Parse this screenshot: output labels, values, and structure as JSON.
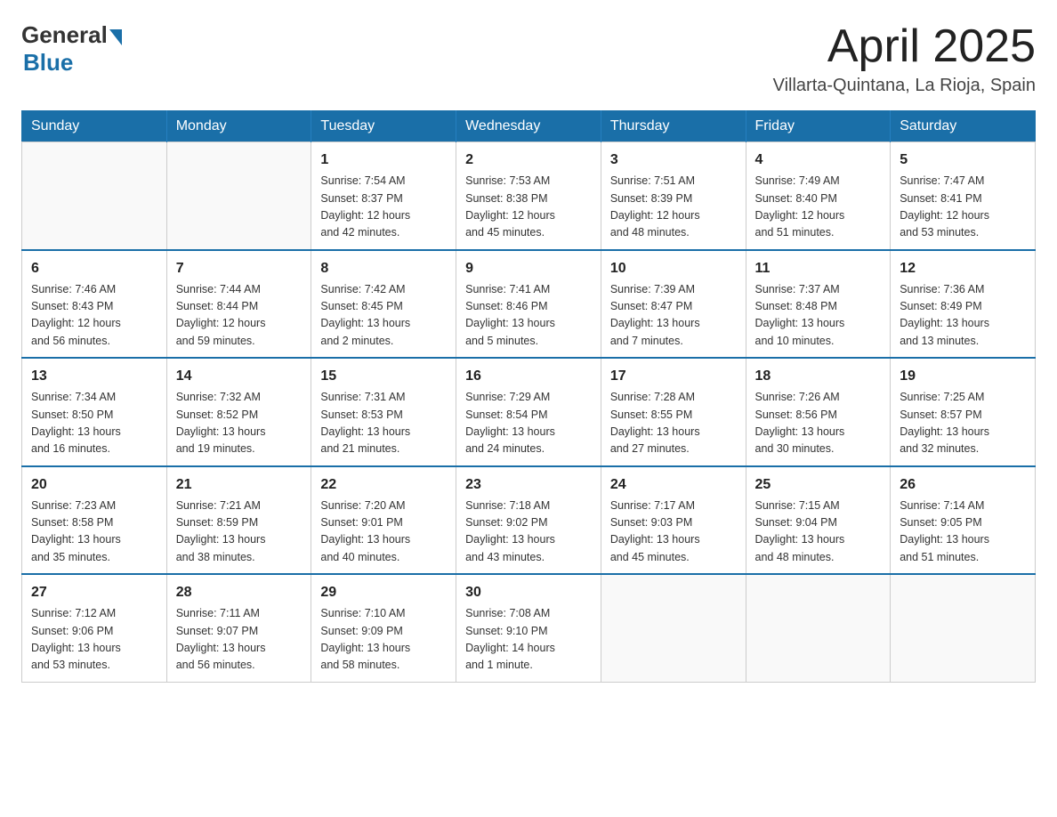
{
  "header": {
    "logo_general": "General",
    "logo_blue": "Blue",
    "title": "April 2025",
    "location": "Villarta-Quintana, La Rioja, Spain"
  },
  "weekdays": [
    "Sunday",
    "Monday",
    "Tuesday",
    "Wednesday",
    "Thursday",
    "Friday",
    "Saturday"
  ],
  "weeks": [
    [
      {
        "day": "",
        "info": ""
      },
      {
        "day": "",
        "info": ""
      },
      {
        "day": "1",
        "info": "Sunrise: 7:54 AM\nSunset: 8:37 PM\nDaylight: 12 hours\nand 42 minutes."
      },
      {
        "day": "2",
        "info": "Sunrise: 7:53 AM\nSunset: 8:38 PM\nDaylight: 12 hours\nand 45 minutes."
      },
      {
        "day": "3",
        "info": "Sunrise: 7:51 AM\nSunset: 8:39 PM\nDaylight: 12 hours\nand 48 minutes."
      },
      {
        "day": "4",
        "info": "Sunrise: 7:49 AM\nSunset: 8:40 PM\nDaylight: 12 hours\nand 51 minutes."
      },
      {
        "day": "5",
        "info": "Sunrise: 7:47 AM\nSunset: 8:41 PM\nDaylight: 12 hours\nand 53 minutes."
      }
    ],
    [
      {
        "day": "6",
        "info": "Sunrise: 7:46 AM\nSunset: 8:43 PM\nDaylight: 12 hours\nand 56 minutes."
      },
      {
        "day": "7",
        "info": "Sunrise: 7:44 AM\nSunset: 8:44 PM\nDaylight: 12 hours\nand 59 minutes."
      },
      {
        "day": "8",
        "info": "Sunrise: 7:42 AM\nSunset: 8:45 PM\nDaylight: 13 hours\nand 2 minutes."
      },
      {
        "day": "9",
        "info": "Sunrise: 7:41 AM\nSunset: 8:46 PM\nDaylight: 13 hours\nand 5 minutes."
      },
      {
        "day": "10",
        "info": "Sunrise: 7:39 AM\nSunset: 8:47 PM\nDaylight: 13 hours\nand 7 minutes."
      },
      {
        "day": "11",
        "info": "Sunrise: 7:37 AM\nSunset: 8:48 PM\nDaylight: 13 hours\nand 10 minutes."
      },
      {
        "day": "12",
        "info": "Sunrise: 7:36 AM\nSunset: 8:49 PM\nDaylight: 13 hours\nand 13 minutes."
      }
    ],
    [
      {
        "day": "13",
        "info": "Sunrise: 7:34 AM\nSunset: 8:50 PM\nDaylight: 13 hours\nand 16 minutes."
      },
      {
        "day": "14",
        "info": "Sunrise: 7:32 AM\nSunset: 8:52 PM\nDaylight: 13 hours\nand 19 minutes."
      },
      {
        "day": "15",
        "info": "Sunrise: 7:31 AM\nSunset: 8:53 PM\nDaylight: 13 hours\nand 21 minutes."
      },
      {
        "day": "16",
        "info": "Sunrise: 7:29 AM\nSunset: 8:54 PM\nDaylight: 13 hours\nand 24 minutes."
      },
      {
        "day": "17",
        "info": "Sunrise: 7:28 AM\nSunset: 8:55 PM\nDaylight: 13 hours\nand 27 minutes."
      },
      {
        "day": "18",
        "info": "Sunrise: 7:26 AM\nSunset: 8:56 PM\nDaylight: 13 hours\nand 30 minutes."
      },
      {
        "day": "19",
        "info": "Sunrise: 7:25 AM\nSunset: 8:57 PM\nDaylight: 13 hours\nand 32 minutes."
      }
    ],
    [
      {
        "day": "20",
        "info": "Sunrise: 7:23 AM\nSunset: 8:58 PM\nDaylight: 13 hours\nand 35 minutes."
      },
      {
        "day": "21",
        "info": "Sunrise: 7:21 AM\nSunset: 8:59 PM\nDaylight: 13 hours\nand 38 minutes."
      },
      {
        "day": "22",
        "info": "Sunrise: 7:20 AM\nSunset: 9:01 PM\nDaylight: 13 hours\nand 40 minutes."
      },
      {
        "day": "23",
        "info": "Sunrise: 7:18 AM\nSunset: 9:02 PM\nDaylight: 13 hours\nand 43 minutes."
      },
      {
        "day": "24",
        "info": "Sunrise: 7:17 AM\nSunset: 9:03 PM\nDaylight: 13 hours\nand 45 minutes."
      },
      {
        "day": "25",
        "info": "Sunrise: 7:15 AM\nSunset: 9:04 PM\nDaylight: 13 hours\nand 48 minutes."
      },
      {
        "day": "26",
        "info": "Sunrise: 7:14 AM\nSunset: 9:05 PM\nDaylight: 13 hours\nand 51 minutes."
      }
    ],
    [
      {
        "day": "27",
        "info": "Sunrise: 7:12 AM\nSunset: 9:06 PM\nDaylight: 13 hours\nand 53 minutes."
      },
      {
        "day": "28",
        "info": "Sunrise: 7:11 AM\nSunset: 9:07 PM\nDaylight: 13 hours\nand 56 minutes."
      },
      {
        "day": "29",
        "info": "Sunrise: 7:10 AM\nSunset: 9:09 PM\nDaylight: 13 hours\nand 58 minutes."
      },
      {
        "day": "30",
        "info": "Sunrise: 7:08 AM\nSunset: 9:10 PM\nDaylight: 14 hours\nand 1 minute."
      },
      {
        "day": "",
        "info": ""
      },
      {
        "day": "",
        "info": ""
      },
      {
        "day": "",
        "info": ""
      }
    ]
  ]
}
